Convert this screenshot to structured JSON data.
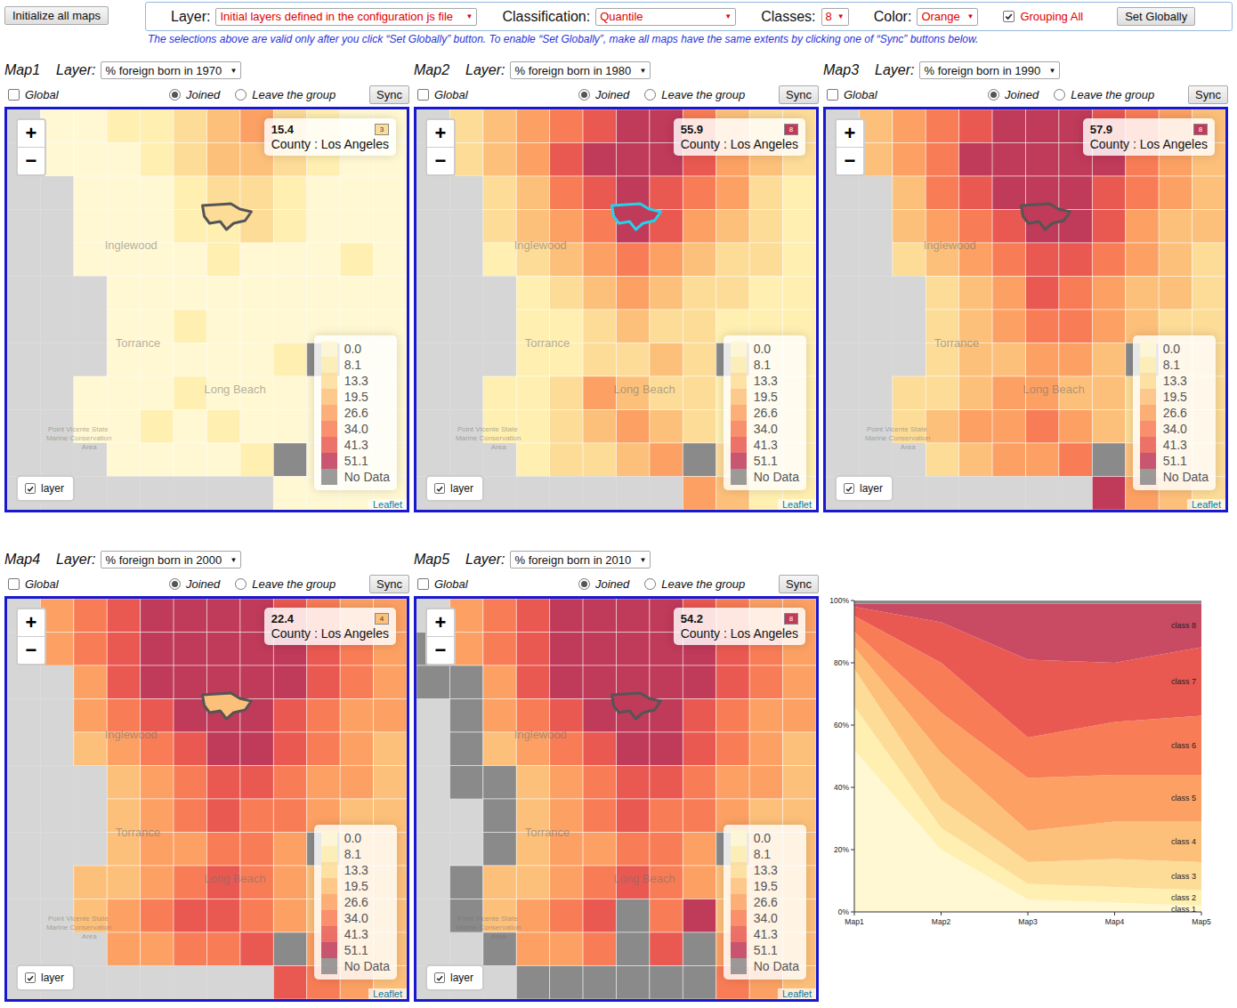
{
  "toolbar": {
    "init_button": "Initialize all maps",
    "layer": {
      "label": "Layer:",
      "value": "Initial layers defined in the configuration js file"
    },
    "classification": {
      "label": "Classification:",
      "value": "Quantile"
    },
    "classes": {
      "label": "Classes:",
      "value": "8"
    },
    "color": {
      "label": "Color:",
      "value": "Orange"
    },
    "grouping": {
      "label": "Grouping All",
      "checked": true
    },
    "set_button": "Set Globally",
    "arrow": "▼",
    "note": "The selections above are valid only after you click “Set Globally” button. To enable “Set Globally”, make all maps have the same extents by clicking one of “Sync” buttons below."
  },
  "map_ui": {
    "layer_label": "Layer:",
    "global_label": "Global",
    "sync": "Sync",
    "zoom_in": "+",
    "zoom_out": "−",
    "layer_toggle": "layer",
    "attribution": "Leaflet"
  },
  "legend": [
    {
      "label": "0.0",
      "color": "#fff8d2"
    },
    {
      "label": "8.1",
      "color": "#ffefb0"
    },
    {
      "label": "13.3",
      "color": "#fddc98"
    },
    {
      "label": "19.5",
      "color": "#fdc07a"
    },
    {
      "label": "26.6",
      "color": "#fca163"
    },
    {
      "label": "34.0",
      "color": "#f87d56"
    },
    {
      "label": "41.3",
      "color": "#e95951"
    },
    {
      "label": "51.1",
      "color": "#c03a5a"
    },
    {
      "label": "No Data",
      "color": "#8a8a8a"
    }
  ],
  "places": [
    "Inglewood",
    "Torrance",
    "Long Beach",
    "Point Vicente State",
    "Marine Conservation",
    "Area"
  ],
  "maps": [
    {
      "title": "Map1",
      "layer": "% foreign born in 1970",
      "global": false,
      "modes": [
        {
          "label": "Joined",
          "selected": true
        },
        {
          "label": "Leave the group",
          "selected": false
        }
      ],
      "layer_visible": true,
      "hovered": false,
      "info": {
        "value": "15.4",
        "class": "3",
        "region": "County : Los Angeles"
      },
      "cells": [
        [
          -1,
          1,
          1,
          2,
          2,
          3,
          4,
          5,
          3,
          2,
          1,
          1
        ],
        [
          -1,
          1,
          1,
          1,
          2,
          3,
          4,
          4,
          3,
          2,
          1,
          1
        ],
        [
          -1,
          -1,
          1,
          1,
          1,
          2,
          3,
          3,
          2,
          1,
          1,
          1
        ],
        [
          -1,
          -1,
          1,
          1,
          1,
          2,
          2,
          3,
          2,
          1,
          1,
          1
        ],
        [
          -1,
          -1,
          1,
          1,
          1,
          1,
          2,
          1,
          1,
          1,
          2,
          1
        ],
        [
          -1,
          -1,
          -1,
          1,
          1,
          1,
          1,
          1,
          1,
          1,
          1,
          1
        ],
        [
          -1,
          -1,
          -1,
          1,
          1,
          2,
          1,
          1,
          1,
          1,
          1,
          1
        ],
        [
          -1,
          -1,
          -1,
          1,
          1,
          1,
          1,
          1,
          2,
          0,
          1,
          1
        ],
        [
          -1,
          -1,
          1,
          1,
          1,
          2,
          1,
          1,
          1,
          1,
          1,
          1
        ],
        [
          -1,
          -1,
          1,
          1,
          2,
          1,
          2,
          1,
          1,
          1,
          1,
          1
        ],
        [
          -1,
          -1,
          -1,
          1,
          1,
          1,
          1,
          2,
          0,
          1,
          1,
          1
        ],
        [
          -1,
          -1,
          -1,
          -1,
          -1,
          -1,
          -1,
          -1,
          1,
          1,
          1,
          1
        ]
      ]
    },
    {
      "title": "Map2",
      "layer": "% foreign born in 1980",
      "global": false,
      "modes": [
        {
          "label": "Joined",
          "selected": true
        },
        {
          "label": "Leave the group",
          "selected": false
        }
      ],
      "layer_visible": true,
      "hovered": true,
      "info": {
        "value": "55.9",
        "class": "8",
        "region": "County : Los Angeles"
      },
      "cells": [
        [
          -1,
          3,
          4,
          5,
          6,
          7,
          8,
          8,
          6,
          4,
          3,
          3
        ],
        [
          -1,
          3,
          4,
          5,
          7,
          8,
          8,
          8,
          7,
          5,
          4,
          3
        ],
        [
          -1,
          -1,
          3,
          4,
          6,
          7,
          8,
          7,
          6,
          5,
          3,
          2
        ],
        [
          -1,
          -1,
          3,
          4,
          5,
          6,
          8,
          7,
          5,
          4,
          3,
          2
        ],
        [
          -1,
          -1,
          2,
          3,
          4,
          5,
          6,
          5,
          4,
          3,
          3,
          2
        ],
        [
          -1,
          -1,
          -1,
          2,
          3,
          4,
          5,
          4,
          3,
          3,
          2,
          2
        ],
        [
          -1,
          -1,
          -1,
          2,
          2,
          3,
          4,
          3,
          3,
          2,
          2,
          2
        ],
        [
          -1,
          -1,
          -1,
          2,
          2,
          3,
          3,
          4,
          3,
          0,
          2,
          2
        ],
        [
          -1,
          -1,
          2,
          2,
          3,
          5,
          4,
          3,
          3,
          2,
          2,
          2
        ],
        [
          -1,
          -1,
          2,
          2,
          3,
          4,
          5,
          4,
          3,
          2,
          2,
          2
        ],
        [
          -1,
          -1,
          -1,
          2,
          3,
          3,
          4,
          5,
          0,
          3,
          2,
          2
        ],
        [
          -1,
          -1,
          -1,
          -1,
          -1,
          -1,
          -1,
          -1,
          5,
          4,
          2,
          2
        ]
      ]
    },
    {
      "title": "Map3",
      "layer": "% foreign born in 1990",
      "global": false,
      "modes": [
        {
          "label": "Joined",
          "selected": true
        },
        {
          "label": "Leave the group",
          "selected": false
        }
      ],
      "layer_visible": true,
      "hovered": false,
      "info": {
        "value": "57.9",
        "class": "8",
        "region": "County : Los Angeles"
      },
      "cells": [
        [
          -1,
          4,
          5,
          6,
          7,
          8,
          8,
          8,
          7,
          6,
          5,
          4
        ],
        [
          -1,
          4,
          5,
          6,
          8,
          8,
          8,
          8,
          8,
          6,
          5,
          4
        ],
        [
          -1,
          -1,
          4,
          6,
          7,
          8,
          8,
          8,
          7,
          6,
          5,
          4
        ],
        [
          -1,
          -1,
          4,
          5,
          6,
          7,
          8,
          8,
          7,
          5,
          4,
          4
        ],
        [
          -1,
          -1,
          3,
          4,
          5,
          6,
          7,
          7,
          6,
          5,
          4,
          3
        ],
        [
          -1,
          -1,
          -1,
          3,
          4,
          5,
          7,
          6,
          5,
          4,
          4,
          3
        ],
        [
          -1,
          -1,
          -1,
          3,
          4,
          5,
          6,
          6,
          5,
          4,
          3,
          3
        ],
        [
          -1,
          -1,
          -1,
          3,
          4,
          4,
          5,
          5,
          4,
          0,
          3,
          3
        ],
        [
          -1,
          -1,
          3,
          3,
          4,
          5,
          5,
          4,
          4,
          3,
          3,
          3
        ],
        [
          -1,
          -1,
          3,
          4,
          5,
          5,
          6,
          5,
          4,
          3,
          3,
          3
        ],
        [
          -1,
          -1,
          -1,
          3,
          4,
          5,
          5,
          6,
          0,
          4,
          3,
          3
        ],
        [
          -1,
          -1,
          -1,
          -1,
          -1,
          -1,
          -1,
          -1,
          8,
          5,
          4,
          3
        ]
      ]
    },
    {
      "title": "Map4",
      "layer": "% foreign born in 2000",
      "global": false,
      "modes": [
        {
          "label": "Joined",
          "selected": true
        },
        {
          "label": "Leave the group",
          "selected": false
        }
      ],
      "layer_visible": true,
      "hovered": false,
      "info": {
        "value": "22.4",
        "class": "4",
        "region": "County : Los Angeles"
      },
      "cells": [
        [
          -1,
          5,
          6,
          7,
          8,
          8,
          8,
          8,
          7,
          6,
          5,
          5
        ],
        [
          -1,
          5,
          6,
          7,
          8,
          8,
          8,
          8,
          8,
          7,
          6,
          5
        ],
        [
          -1,
          -1,
          5,
          7,
          8,
          8,
          8,
          8,
          8,
          7,
          6,
          5
        ],
        [
          -1,
          -1,
          5,
          6,
          7,
          8,
          8,
          8,
          7,
          6,
          5,
          5
        ],
        [
          -1,
          -1,
          4,
          5,
          6,
          7,
          8,
          8,
          7,
          6,
          5,
          4
        ],
        [
          -1,
          -1,
          -1,
          4,
          5,
          6,
          7,
          7,
          6,
          5,
          5,
          4
        ],
        [
          -1,
          -1,
          -1,
          4,
          5,
          6,
          7,
          6,
          6,
          5,
          4,
          4
        ],
        [
          -1,
          -1,
          -1,
          4,
          5,
          5,
          6,
          6,
          5,
          0,
          4,
          4
        ],
        [
          -1,
          -1,
          4,
          4,
          5,
          6,
          7,
          6,
          5,
          4,
          4,
          4
        ],
        [
          -1,
          -1,
          4,
          5,
          6,
          7,
          7,
          6,
          5,
          4,
          4,
          4
        ],
        [
          -1,
          -1,
          -1,
          5,
          5,
          6,
          6,
          7,
          0,
          5,
          4,
          4
        ],
        [
          -1,
          -1,
          -1,
          -1,
          -1,
          -1,
          -1,
          -1,
          7,
          6,
          5,
          4
        ]
      ]
    },
    {
      "title": "Map5",
      "layer": "% foreign born in 2010",
      "global": false,
      "modes": [
        {
          "label": "Joined",
          "selected": true
        },
        {
          "label": "Leave the group",
          "selected": false
        }
      ],
      "layer_visible": true,
      "hovered": false,
      "info": {
        "value": "54.2",
        "class": "8",
        "region": "County : Los Angeles"
      },
      "cells": [
        [
          -1,
          5,
          6,
          7,
          8,
          8,
          8,
          8,
          7,
          6,
          5,
          5
        ],
        [
          0,
          5,
          6,
          7,
          8,
          8,
          8,
          8,
          8,
          7,
          6,
          5
        ],
        [
          0,
          0,
          5,
          7,
          8,
          8,
          8,
          8,
          8,
          7,
          6,
          5
        ],
        [
          -1,
          0,
          5,
          6,
          7,
          8,
          8,
          8,
          7,
          6,
          5,
          5
        ],
        [
          -1,
          0,
          4,
          5,
          6,
          7,
          8,
          8,
          7,
          6,
          5,
          4
        ],
        [
          -1,
          0,
          0,
          4,
          5,
          6,
          7,
          7,
          6,
          5,
          5,
          4
        ],
        [
          -1,
          -1,
          0,
          4,
          5,
          6,
          7,
          6,
          6,
          5,
          4,
          4
        ],
        [
          -1,
          -1,
          0,
          4,
          5,
          5,
          6,
          6,
          5,
          0,
          4,
          4
        ],
        [
          -1,
          0,
          4,
          4,
          5,
          6,
          7,
          6,
          5,
          4,
          4,
          4
        ],
        [
          -1,
          0,
          4,
          5,
          6,
          7,
          0,
          6,
          8,
          4,
          4,
          4
        ],
        [
          -1,
          -1,
          0,
          5,
          5,
          6,
          0,
          7,
          0,
          5,
          4,
          4
        ],
        [
          -1,
          -1,
          -1,
          0,
          0,
          0,
          0,
          0,
          0,
          6,
          5,
          4
        ]
      ]
    }
  ],
  "chart": {
    "y_ticks": [
      "0%",
      "20%",
      "40%",
      "60%",
      "80%",
      "100%"
    ],
    "x_ticks": [
      "Map1",
      "Map2",
      "Map3",
      "Map4",
      "Map5"
    ],
    "series": [
      {
        "label": "class 1",
        "color": "#fff8d2",
        "values": [
          52,
          20,
          4,
          3,
          2
        ]
      },
      {
        "label": "class 2",
        "color": "#ffefb0",
        "values": [
          14,
          7,
          5,
          5,
          5
        ]
      },
      {
        "label": "class 3",
        "color": "#fddc98",
        "values": [
          12,
          9,
          7,
          9,
          9
        ]
      },
      {
        "label": "class 4",
        "color": "#fdc07a",
        "values": [
          7,
          15,
          10,
          12,
          13
        ]
      },
      {
        "label": "class 5",
        "color": "#fca163",
        "values": [
          5,
          13,
          17,
          15,
          15
        ]
      },
      {
        "label": "class 6",
        "color": "#f87d56",
        "values": [
          5,
          16,
          13,
          17,
          19
        ]
      },
      {
        "label": "class 7",
        "color": "#e95951",
        "values": [
          3,
          13,
          25,
          19,
          22
        ]
      },
      {
        "label": "class 8",
        "color": "#c94a63",
        "values": [
          1,
          6,
          18,
          19,
          14
        ]
      }
    ],
    "no_data_series": {
      "color": "#8a8a8a",
      "values": [
        1,
        1,
        1,
        1,
        1
      ]
    }
  }
}
